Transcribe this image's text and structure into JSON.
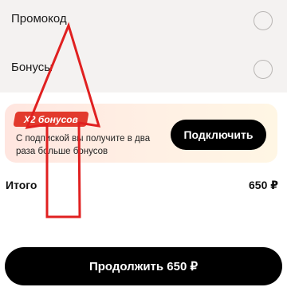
{
  "options": {
    "promo_label": "Промокод",
    "bonus_label": "Бонусы"
  },
  "promo_card": {
    "badge": "X2 бонусов",
    "text": "С подпиской вы получите в два раза больше бонусов",
    "button": "Подключить"
  },
  "total": {
    "label": "Итого",
    "value": "650 ₽"
  },
  "continue_button": "Продолжить 650 ₽",
  "colors": {
    "accent": "#e23a2d",
    "annotation": "#e02020",
    "button": "#000000"
  }
}
